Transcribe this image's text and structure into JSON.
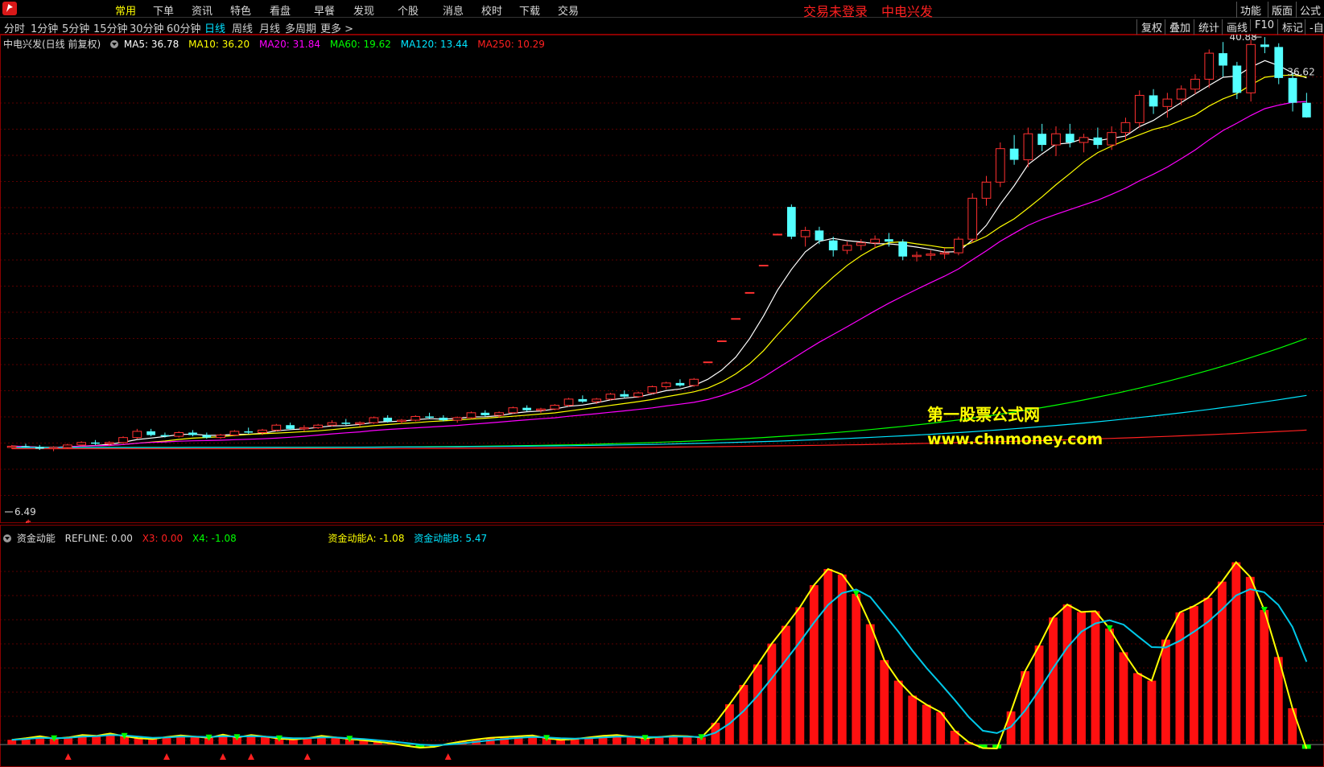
{
  "menu": {
    "items": [
      "常用",
      "下单",
      "资讯",
      "特色",
      "看盘",
      "早餐",
      "发现",
      "个股",
      "消息",
      "校时",
      "下载",
      "交易"
    ],
    "active_index": 0,
    "notice_login": "交易未登录",
    "notice_stock": "中电兴发",
    "right": [
      "功能",
      "版面",
      "公式"
    ]
  },
  "periods": {
    "items": [
      "分时",
      "1分钟",
      "5分钟",
      "15分钟",
      "30分钟",
      "60分钟",
      "日线",
      "周线",
      "月线",
      "多周期",
      "更多 >"
    ],
    "active_index": 6,
    "tools": [
      "复权",
      "叠加",
      "统计",
      "画线",
      "F10",
      "标记",
      "-自"
    ]
  },
  "main_legend": {
    "title": "中电兴发(日线 前复权)",
    "ma": [
      {
        "label": "MA5: 36.78",
        "color": "#ffffff"
      },
      {
        "label": "MA10: 36.20",
        "color": "#ffff00"
      },
      {
        "label": "MA20: 31.84",
        "color": "#ff00ff"
      },
      {
        "label": "MA60: 19.62",
        "color": "#00ff00"
      },
      {
        "label": "MA120: 13.44",
        "color": "#00e5ff"
      },
      {
        "label": "MA250: 10.29",
        "color": "#ff2020"
      }
    ]
  },
  "sub_legend": {
    "title": "资金动能",
    "items": [
      {
        "label": "REFLINE: 0.00",
        "color": "#dcdcdc"
      },
      {
        "label": "X3: 0.00",
        "color": "#ff2020"
      },
      {
        "label": "X4: -1.08",
        "color": "#00ff00"
      },
      {
        "label": "资金动能A: -1.08",
        "color": "#ffff00"
      },
      {
        "label": "资金动能B: 5.47",
        "color": "#00e5ff"
      }
    ]
  },
  "watermark": {
    "line1": "第一股票公式网",
    "line2": "www.chnmoney.com"
  },
  "colors": {
    "up": "#ff3030",
    "down": "#54ffff",
    "grid": "#5a0000",
    "border": "#8a0000"
  },
  "chart_data": [
    {
      "type": "candlestick",
      "price_labels": {
        "high": "40.88",
        "last": "36.62",
        "low": "6.49"
      },
      "ylim": [
        5,
        42
      ],
      "candles": [
        [
          10,
          10.2,
          9.9,
          10.1
        ],
        [
          10.1,
          10.3,
          10.0,
          10.05
        ],
        [
          10.05,
          10.2,
          9.8,
          9.9
        ],
        [
          9.9,
          10.1,
          9.7,
          10.0
        ],
        [
          10.0,
          10.3,
          9.9,
          10.2
        ],
        [
          10.2,
          10.5,
          10.1,
          10.4
        ],
        [
          10.4,
          10.6,
          10.2,
          10.3
        ],
        [
          10.3,
          10.5,
          10.1,
          10.4
        ],
        [
          10.4,
          10.9,
          10.3,
          10.8
        ],
        [
          10.8,
          11.5,
          10.7,
          11.3
        ],
        [
          11.3,
          11.5,
          10.9,
          11.0
        ],
        [
          11.0,
          11.2,
          10.8,
          10.9
        ],
        [
          10.9,
          11.3,
          10.8,
          11.2
        ],
        [
          11.2,
          11.4,
          10.9,
          11.0
        ],
        [
          11.0,
          11.2,
          10.7,
          10.8
        ],
        [
          10.8,
          11.1,
          10.7,
          11.0
        ],
        [
          11.0,
          11.4,
          10.9,
          11.3
        ],
        [
          11.3,
          11.6,
          11.1,
          11.2
        ],
        [
          11.2,
          11.5,
          11.0,
          11.4
        ],
        [
          11.4,
          11.9,
          11.3,
          11.8
        ],
        [
          11.8,
          12.0,
          11.4,
          11.5
        ],
        [
          11.5,
          11.8,
          11.3,
          11.6
        ],
        [
          11.6,
          11.9,
          11.5,
          11.8
        ],
        [
          11.8,
          12.2,
          11.7,
          12.0
        ],
        [
          12.0,
          12.3,
          11.8,
          11.9
        ],
        [
          11.9,
          12.1,
          11.7,
          12.0
        ],
        [
          12.0,
          12.5,
          11.9,
          12.4
        ],
        [
          12.4,
          12.6,
          12.0,
          12.1
        ],
        [
          12.1,
          12.3,
          11.9,
          12.2
        ],
        [
          12.2,
          12.6,
          12.1,
          12.5
        ],
        [
          12.5,
          12.8,
          12.3,
          12.4
        ],
        [
          12.4,
          12.6,
          12.1,
          12.2
        ],
        [
          12.2,
          12.5,
          12.0,
          12.4
        ],
        [
          12.4,
          12.9,
          12.3,
          12.8
        ],
        [
          12.8,
          13.0,
          12.5,
          12.6
        ],
        [
          12.6,
          12.9,
          12.4,
          12.8
        ],
        [
          12.8,
          13.3,
          12.7,
          13.2
        ],
        [
          13.2,
          13.4,
          12.9,
          13.0
        ],
        [
          13.0,
          13.2,
          12.8,
          13.1
        ],
        [
          13.1,
          13.5,
          13.0,
          13.4
        ],
        [
          13.4,
          14.0,
          13.3,
          13.9
        ],
        [
          13.9,
          14.2,
          13.6,
          13.7
        ],
        [
          13.7,
          14.0,
          13.5,
          13.9
        ],
        [
          13.9,
          14.4,
          13.8,
          14.3
        ],
        [
          14.3,
          14.6,
          14.0,
          14.1
        ],
        [
          14.1,
          14.5,
          14.0,
          14.4
        ],
        [
          14.4,
          15.0,
          14.3,
          14.9
        ],
        [
          14.9,
          15.3,
          14.7,
          15.2
        ],
        [
          15.2,
          15.5,
          14.9,
          15.0
        ],
        [
          15.0,
          15.6,
          14.9,
          15.5
        ],
        [
          16.9,
          16.9,
          16.9,
          16.9
        ],
        [
          18.6,
          18.6,
          18.6,
          18.6
        ],
        [
          20.4,
          20.4,
          20.4,
          20.4
        ],
        [
          22.5,
          22.5,
          22.5,
          22.5
        ],
        [
          24.7,
          24.7,
          24.7,
          24.7
        ],
        [
          27.2,
          27.2,
          27.2,
          27.2
        ],
        [
          29.4,
          29.6,
          26.8,
          27.0
        ],
        [
          27.0,
          27.8,
          26.2,
          27.5
        ],
        [
          27.5,
          27.8,
          26.4,
          26.7
        ],
        [
          26.7,
          27.0,
          25.4,
          25.9
        ],
        [
          25.9,
          26.6,
          25.6,
          26.3
        ],
        [
          26.3,
          26.8,
          25.9,
          26.5
        ],
        [
          26.5,
          27.1,
          26.1,
          26.8
        ],
        [
          26.8,
          27.3,
          26.2,
          26.6
        ],
        [
          26.6,
          26.8,
          25.1,
          25.4
        ],
        [
          25.4,
          25.8,
          25.0,
          25.5
        ],
        [
          25.5,
          25.9,
          25.1,
          25.6
        ],
        [
          25.6,
          26.1,
          25.2,
          25.7
        ],
        [
          25.7,
          27.0,
          25.5,
          26.8
        ],
        [
          26.8,
          30.5,
          26.5,
          30.1
        ],
        [
          30.1,
          31.9,
          29.5,
          31.4
        ],
        [
          31.4,
          34.6,
          31.0,
          34.1
        ],
        [
          34.1,
          35.2,
          32.8,
          33.2
        ],
        [
          33.2,
          35.8,
          32.6,
          35.3
        ],
        [
          35.3,
          36.1,
          33.9,
          34.4
        ],
        [
          34.4,
          35.9,
          33.5,
          35.3
        ],
        [
          35.3,
          36.1,
          34.2,
          34.6
        ],
        [
          34.6,
          35.3,
          33.8,
          35.0
        ],
        [
          35.0,
          35.8,
          34.1,
          34.4
        ],
        [
          34.4,
          35.9,
          34.0,
          35.4
        ],
        [
          35.4,
          36.6,
          34.8,
          36.2
        ],
        [
          36.2,
          38.8,
          35.8,
          38.4
        ],
        [
          38.4,
          38.9,
          36.9,
          37.5
        ],
        [
          37.5,
          38.6,
          36.6,
          38.1
        ],
        [
          38.1,
          39.2,
          37.6,
          38.9
        ],
        [
          38.9,
          40.1,
          38.5,
          39.7
        ],
        [
          39.7,
          42.1,
          39.0,
          41.8
        ],
        [
          41.8,
          42.7,
          39.9,
          40.8
        ],
        [
          40.8,
          41.1,
          38.1,
          38.6
        ],
        [
          38.6,
          42.9,
          37.9,
          42.5
        ],
        [
          42.5,
          43.1,
          41.8,
          42.3
        ],
        [
          42.3,
          42.6,
          39.3,
          39.8
        ],
        [
          39.8,
          40.2,
          37.1,
          37.8
        ],
        [
          37.8,
          38.6,
          36.6,
          36.62
        ]
      ]
    },
    {
      "type": "bar+line",
      "ylim": [
        -1,
        50
      ],
      "values": [
        1.2,
        1.6,
        2.1,
        1.5,
        1.8,
        2.4,
        2.2,
        2.8,
        2.1,
        1.6,
        1.4,
        1.9,
        2.3,
        2.0,
        1.7,
        2.5,
        1.8,
        2.4,
        2.0,
        1.5,
        1.3,
        1.6,
        2.2,
        1.8,
        1.4,
        1.1,
        0.7,
        0.3,
        -0.3,
        -0.8,
        -0.6,
        0.2,
        0.8,
        1.3,
        1.7,
        1.9,
        2.1,
        2.3,
        1.6,
        1.2,
        1.4,
        1.8,
        2.2,
        2.4,
        2.0,
        1.6,
        1.9,
        2.2,
        2.1,
        1.8,
        5.5,
        10.2,
        15.1,
        20.3,
        25.6,
        30.1,
        34.8,
        40.4,
        44.5,
        43.1,
        38.2,
        30.5,
        21.4,
        16.2,
        12.4,
        10.1,
        8.2,
        3.5,
        0.6,
        -0.9,
        -1.0,
        8.4,
        18.6,
        25.1,
        32.2,
        35.5,
        33.6,
        33.8,
        29.4,
        23.4,
        18.1,
        16.2,
        26.6,
        33.5,
        35.1,
        37.2,
        41.3,
        46.2,
        42.5,
        34.1,
        22.2,
        9.2,
        -1.08
      ],
      "smooth": [
        1.2,
        1.4,
        1.7,
        1.6,
        1.7,
        2.0,
        2.1,
        2.4,
        2.3,
        2.0,
        1.7,
        1.8,
        2.0,
        2.0,
        1.9,
        2.1,
        2.0,
        2.1,
        2.0,
        1.8,
        1.6,
        1.6,
        1.8,
        1.8,
        1.6,
        1.4,
        1.1,
        0.8,
        0.4,
        0.0,
        -0.2,
        0.0,
        0.3,
        0.7,
        1.1,
        1.4,
        1.7,
        1.9,
        1.8,
        1.6,
        1.5,
        1.6,
        1.8,
        2.0,
        2.0,
        1.9,
        1.9,
        2.0,
        2.0,
        1.9,
        3.0,
        5.3,
        8.5,
        12.4,
        16.8,
        21.4,
        26.0,
        30.9,
        35.4,
        38.4,
        39.3,
        37.4,
        33.0,
        28.6,
        23.8,
        19.4,
        15.4,
        11.3,
        7.0,
        3.5,
        2.9,
        4.5,
        8.6,
        13.8,
        19.4,
        24.6,
        28.6,
        30.7,
        31.5,
        30.4,
        27.5,
        24.7,
        24.6,
        26.3,
        28.6,
        31.1,
        34.3,
        37.8,
        39.4,
        38.6,
        35.4,
        29.8,
        21.0
      ]
    }
  ]
}
